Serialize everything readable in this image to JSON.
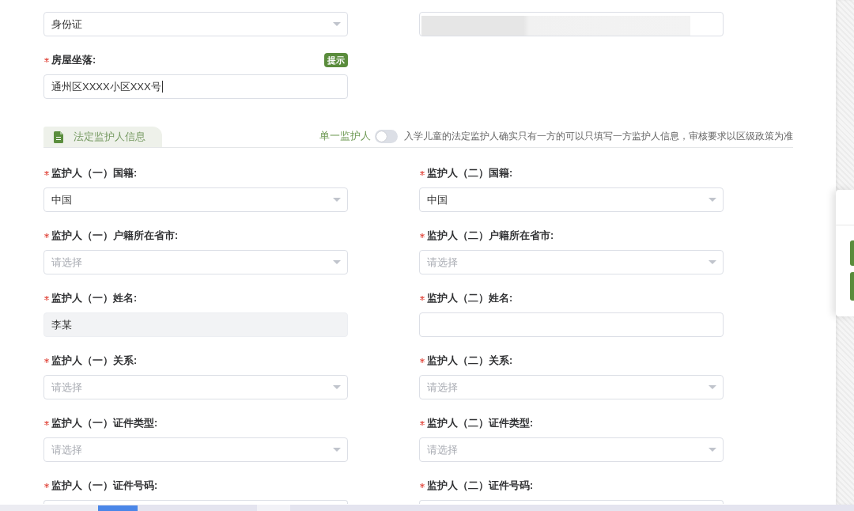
{
  "top_fields": [
    {
      "kind": "select",
      "value": "身份证",
      "redacted": false
    },
    {
      "kind": "input",
      "redacted": true
    }
  ],
  "address": {
    "label": "房屋坐落:",
    "required": true,
    "hint_badge": "提示",
    "value": "通州区XXXX小区XXX号",
    "focused": true
  },
  "section": {
    "tab": {
      "label": "法定监护人信息",
      "selected": true
    },
    "single_guardian": {
      "label": "单一监护人",
      "on": false
    },
    "note": "入学儿童的法定监护人确实只有一方的可以只填写一方监护人信息，审核要求以区级政策为准"
  },
  "guardian_fields": [
    {
      "label": "监护人（一）国籍:",
      "required": true,
      "kind": "select",
      "value": "中国",
      "disabled": false,
      "cut_off": false
    },
    {
      "label": "监护人（二）国籍:",
      "required": true,
      "kind": "select",
      "value": "中国",
      "disabled": false,
      "cut_off": false
    },
    {
      "label": "监护人（一）户籍所在省市:",
      "required": true,
      "kind": "select",
      "placeholder": "请选择",
      "disabled": false,
      "cut_off": false
    },
    {
      "label": "监护人（二）户籍所在省市:",
      "required": true,
      "kind": "select",
      "placeholder": "请选择",
      "disabled": false,
      "cut_off": false
    },
    {
      "label": "监护人（一）姓名:",
      "required": true,
      "kind": "input",
      "value": "李某",
      "disabled": true,
      "cut_off": false
    },
    {
      "label": "监护人（二）姓名:",
      "required": true,
      "kind": "input",
      "disabled": false,
      "cut_off": false
    },
    {
      "label": "监护人（一）关系:",
      "required": true,
      "kind": "select",
      "placeholder": "请选择",
      "disabled": false,
      "cut_off": false
    },
    {
      "label": "监护人（二）关系:",
      "required": true,
      "kind": "select",
      "placeholder": "请选择",
      "disabled": false,
      "cut_off": false
    },
    {
      "label": "监护人（一）证件类型:",
      "required": true,
      "kind": "select",
      "placeholder": "请选择",
      "disabled": false,
      "cut_off": false
    },
    {
      "label": "监护人（二）证件类型:",
      "required": true,
      "kind": "select",
      "placeholder": "请选择",
      "disabled": false,
      "cut_off": false
    },
    {
      "label": "监护人（一）证件号码:",
      "required": true,
      "kind": "input",
      "disabled": false,
      "cut_off": true
    },
    {
      "label": "监护人（二）证件号码:",
      "required": true,
      "kind": "input",
      "disabled": false,
      "cut_off": true
    }
  ]
}
